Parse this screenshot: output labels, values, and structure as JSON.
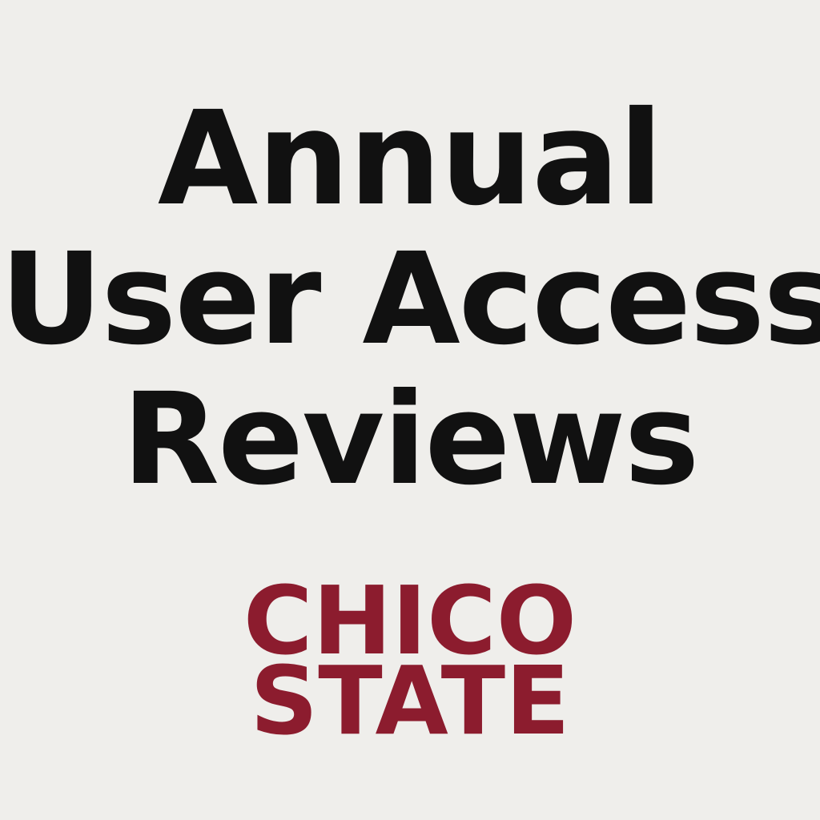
{
  "title": {
    "lines": [
      "Annual",
      "User Access",
      "Reviews"
    ]
  },
  "logo": {
    "lines": [
      "CHICO",
      "STATE"
    ],
    "color": "#8c1c2e"
  },
  "colors": {
    "background": "#efeeeb",
    "text": "#111111"
  }
}
